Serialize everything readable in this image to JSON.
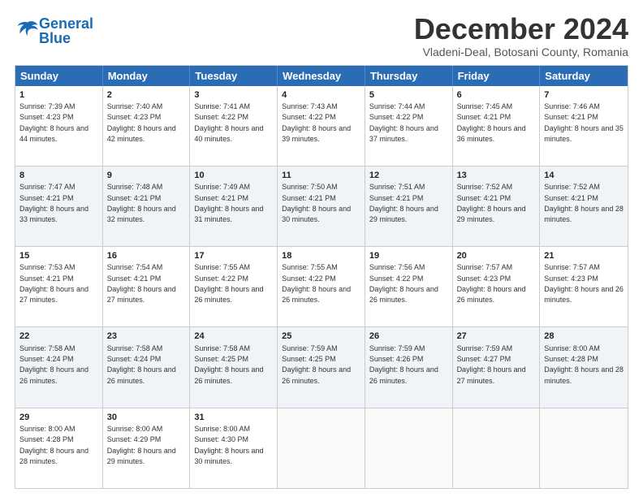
{
  "logo": {
    "text_general": "General",
    "text_blue": "Blue"
  },
  "title": "December 2024",
  "subtitle": "Vladeni-Deal, Botosani County, Romania",
  "header_days": [
    "Sunday",
    "Monday",
    "Tuesday",
    "Wednesday",
    "Thursday",
    "Friday",
    "Saturday"
  ],
  "weeks": [
    [
      {
        "day": "1",
        "rise": "Sunrise: 7:39 AM",
        "set": "Sunset: 4:23 PM",
        "light": "Daylight: 8 hours and 44 minutes."
      },
      {
        "day": "2",
        "rise": "Sunrise: 7:40 AM",
        "set": "Sunset: 4:23 PM",
        "light": "Daylight: 8 hours and 42 minutes."
      },
      {
        "day": "3",
        "rise": "Sunrise: 7:41 AM",
        "set": "Sunset: 4:22 PM",
        "light": "Daylight: 8 hours and 40 minutes."
      },
      {
        "day": "4",
        "rise": "Sunrise: 7:43 AM",
        "set": "Sunset: 4:22 PM",
        "light": "Daylight: 8 hours and 39 minutes."
      },
      {
        "day": "5",
        "rise": "Sunrise: 7:44 AM",
        "set": "Sunset: 4:22 PM",
        "light": "Daylight: 8 hours and 37 minutes."
      },
      {
        "day": "6",
        "rise": "Sunrise: 7:45 AM",
        "set": "Sunset: 4:21 PM",
        "light": "Daylight: 8 hours and 36 minutes."
      },
      {
        "day": "7",
        "rise": "Sunrise: 7:46 AM",
        "set": "Sunset: 4:21 PM",
        "light": "Daylight: 8 hours and 35 minutes."
      }
    ],
    [
      {
        "day": "8",
        "rise": "Sunrise: 7:47 AM",
        "set": "Sunset: 4:21 PM",
        "light": "Daylight: 8 hours and 33 minutes."
      },
      {
        "day": "9",
        "rise": "Sunrise: 7:48 AM",
        "set": "Sunset: 4:21 PM",
        "light": "Daylight: 8 hours and 32 minutes."
      },
      {
        "day": "10",
        "rise": "Sunrise: 7:49 AM",
        "set": "Sunset: 4:21 PM",
        "light": "Daylight: 8 hours and 31 minutes."
      },
      {
        "day": "11",
        "rise": "Sunrise: 7:50 AM",
        "set": "Sunset: 4:21 PM",
        "light": "Daylight: 8 hours and 30 minutes."
      },
      {
        "day": "12",
        "rise": "Sunrise: 7:51 AM",
        "set": "Sunset: 4:21 PM",
        "light": "Daylight: 8 hours and 29 minutes."
      },
      {
        "day": "13",
        "rise": "Sunrise: 7:52 AM",
        "set": "Sunset: 4:21 PM",
        "light": "Daylight: 8 hours and 29 minutes."
      },
      {
        "day": "14",
        "rise": "Sunrise: 7:52 AM",
        "set": "Sunset: 4:21 PM",
        "light": "Daylight: 8 hours and 28 minutes."
      }
    ],
    [
      {
        "day": "15",
        "rise": "Sunrise: 7:53 AM",
        "set": "Sunset: 4:21 PM",
        "light": "Daylight: 8 hours and 27 minutes."
      },
      {
        "day": "16",
        "rise": "Sunrise: 7:54 AM",
        "set": "Sunset: 4:21 PM",
        "light": "Daylight: 8 hours and 27 minutes."
      },
      {
        "day": "17",
        "rise": "Sunrise: 7:55 AM",
        "set": "Sunset: 4:22 PM",
        "light": "Daylight: 8 hours and 26 minutes."
      },
      {
        "day": "18",
        "rise": "Sunrise: 7:55 AM",
        "set": "Sunset: 4:22 PM",
        "light": "Daylight: 8 hours and 26 minutes."
      },
      {
        "day": "19",
        "rise": "Sunrise: 7:56 AM",
        "set": "Sunset: 4:22 PM",
        "light": "Daylight: 8 hours and 26 minutes."
      },
      {
        "day": "20",
        "rise": "Sunrise: 7:57 AM",
        "set": "Sunset: 4:23 PM",
        "light": "Daylight: 8 hours and 26 minutes."
      },
      {
        "day": "21",
        "rise": "Sunrise: 7:57 AM",
        "set": "Sunset: 4:23 PM",
        "light": "Daylight: 8 hours and 26 minutes."
      }
    ],
    [
      {
        "day": "22",
        "rise": "Sunrise: 7:58 AM",
        "set": "Sunset: 4:24 PM",
        "light": "Daylight: 8 hours and 26 minutes."
      },
      {
        "day": "23",
        "rise": "Sunrise: 7:58 AM",
        "set": "Sunset: 4:24 PM",
        "light": "Daylight: 8 hours and 26 minutes."
      },
      {
        "day": "24",
        "rise": "Sunrise: 7:58 AM",
        "set": "Sunset: 4:25 PM",
        "light": "Daylight: 8 hours and 26 minutes."
      },
      {
        "day": "25",
        "rise": "Sunrise: 7:59 AM",
        "set": "Sunset: 4:25 PM",
        "light": "Daylight: 8 hours and 26 minutes."
      },
      {
        "day": "26",
        "rise": "Sunrise: 7:59 AM",
        "set": "Sunset: 4:26 PM",
        "light": "Daylight: 8 hours and 26 minutes."
      },
      {
        "day": "27",
        "rise": "Sunrise: 7:59 AM",
        "set": "Sunset: 4:27 PM",
        "light": "Daylight: 8 hours and 27 minutes."
      },
      {
        "day": "28",
        "rise": "Sunrise: 8:00 AM",
        "set": "Sunset: 4:28 PM",
        "light": "Daylight: 8 hours and 28 minutes."
      }
    ],
    [
      {
        "day": "29",
        "rise": "Sunrise: 8:00 AM",
        "set": "Sunset: 4:28 PM",
        "light": "Daylight: 8 hours and 28 minutes."
      },
      {
        "day": "30",
        "rise": "Sunrise: 8:00 AM",
        "set": "Sunset: 4:29 PM",
        "light": "Daylight: 8 hours and 29 minutes."
      },
      {
        "day": "31",
        "rise": "Sunrise: 8:00 AM",
        "set": "Sunset: 4:30 PM",
        "light": "Daylight: 8 hours and 30 minutes."
      },
      null,
      null,
      null,
      null
    ]
  ]
}
